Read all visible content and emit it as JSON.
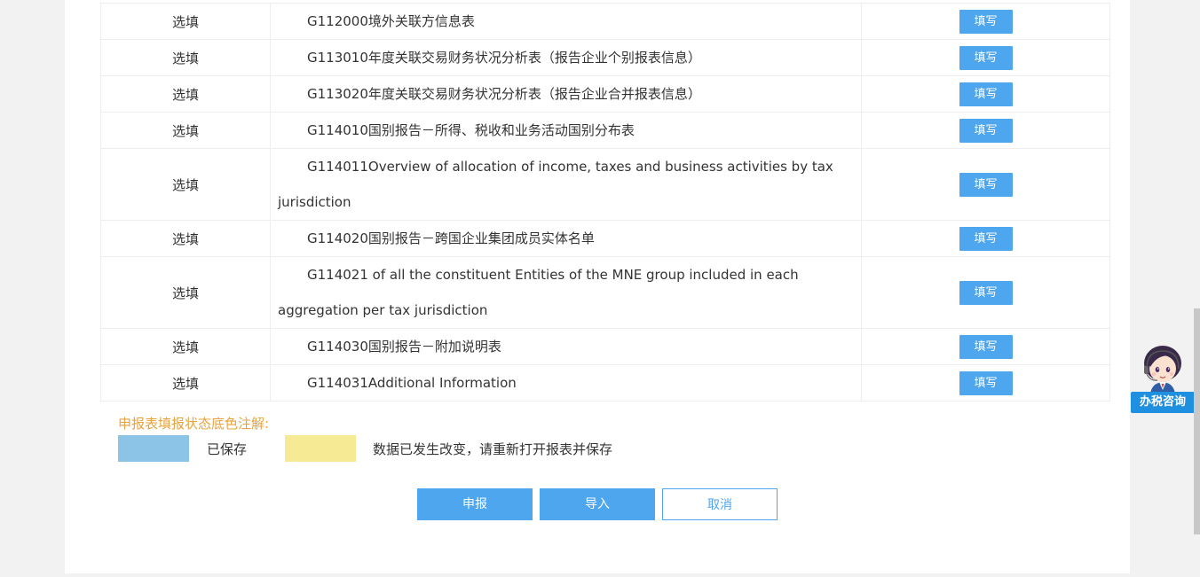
{
  "rows": [
    {
      "required": "选填",
      "name": "G112000境外关联方信息表",
      "action": "填写",
      "tall": false
    },
    {
      "required": "选填",
      "name": "G113010年度关联交易财务状况分析表（报告企业个别报表信息）",
      "action": "填写",
      "tall": false
    },
    {
      "required": "选填",
      "name": "G113020年度关联交易财务状况分析表（报告企业合并报表信息）",
      "action": "填写",
      "tall": false
    },
    {
      "required": "选填",
      "name": "G114010国别报告－所得、税收和业务活动国别分布表",
      "action": "填写",
      "tall": false
    },
    {
      "required": "选填",
      "name": "G114011Overview of allocation of income, taxes and business activities by tax jurisdiction",
      "action": "填写",
      "tall": true
    },
    {
      "required": "选填",
      "name": "G114020国别报告－跨国企业集团成员实体名单",
      "action": "填写",
      "tall": false
    },
    {
      "required": "选填",
      "name": "G114021 of all the constituent Entities of the MNE group included in each aggregation per tax jurisdiction",
      "action": "填写",
      "tall": true
    },
    {
      "required": "选填",
      "name": "G114030国别报告－附加说明表",
      "action": "填写",
      "tall": false
    },
    {
      "required": "选填",
      "name": "G114031Additional Information",
      "action": "填写",
      "tall": false
    }
  ],
  "legend": {
    "title": "申报表填报状态底色注解:",
    "saved_label": "已保存",
    "saved_color": "#8cc4e8",
    "changed_label": "数据已发生改变，请重新打开报表并保存",
    "changed_color": "#f6ea94"
  },
  "actions": {
    "submit": "申报",
    "import": "导入",
    "cancel": "取消"
  },
  "widget": {
    "consult_label": "办税咨询",
    "avatar_icon": "customer-service-avatar-icon"
  },
  "colors": {
    "accent": "#4da6ee",
    "legend_title": "#e8a33d"
  }
}
